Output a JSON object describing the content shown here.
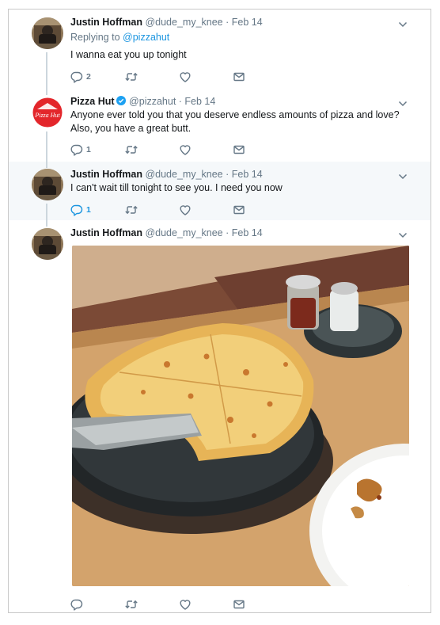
{
  "tweets": [
    {
      "name": "Justin Hoffman",
      "handle": "@dude_my_knee",
      "time": "· Feb 14",
      "replying_prefix": "Replying to",
      "replying_handle": "@pizzahut",
      "text": "I wanna eat you up tonight",
      "reply_count": "2"
    },
    {
      "name": "Pizza Hut",
      "handle": "@pizzahut",
      "time": "· Feb 14",
      "text_line1": "Anyone ever told you that you deserve endless amounts of pizza and love?",
      "text_line2": "Also, you have a great butt.",
      "reply_count": "1",
      "avatar_logo_text": "Pizza Hut"
    },
    {
      "name": "Justin Hoffman",
      "handle": "@dude_my_knee",
      "time": "· Feb 14",
      "text": "I can't wait till tonight to see you. I need you now",
      "reply_count": "1"
    },
    {
      "name": "Justin Hoffman",
      "handle": "@dude_my_knee",
      "time": "· Feb 14"
    }
  ],
  "icons": {
    "reply": "reply-icon",
    "retweet": "retweet-icon",
    "like": "heart-icon",
    "message": "envelope-icon",
    "more": "chevron-down-icon",
    "verified": "verified-badge-icon"
  },
  "colors": {
    "text": "#14171a",
    "muted": "#657786",
    "link": "#1b95e0",
    "highlight_bg": "#f5f8fa",
    "pizza_hut_red": "#e3262b"
  }
}
